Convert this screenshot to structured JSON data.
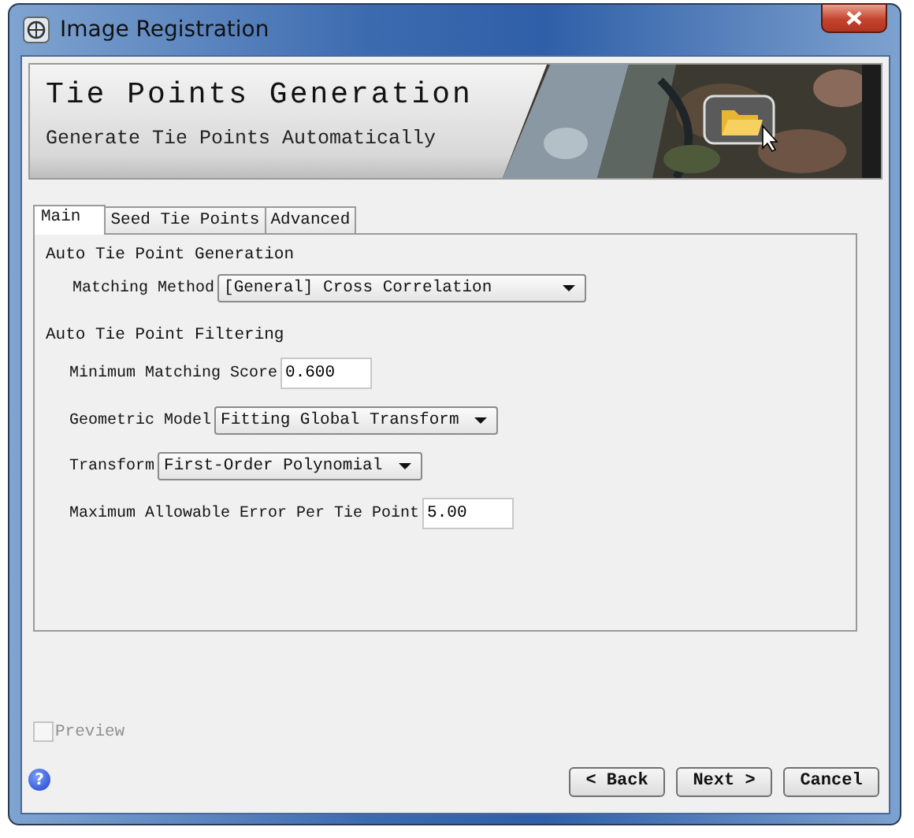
{
  "window": {
    "title": "Image Registration"
  },
  "banner": {
    "title": "Tie Points Generation",
    "subtitle": "Generate Tie Points Automatically"
  },
  "tabs": [
    {
      "label": "Main",
      "selected": true
    },
    {
      "label": "Seed Tie Points",
      "selected": false
    },
    {
      "label": "Advanced",
      "selected": false
    }
  ],
  "sections": [
    {
      "heading": "Auto Tie Point Generation",
      "fields": [
        {
          "kind": "dropdown",
          "label": "Matching Method",
          "value": "[General] Cross Correlation"
        }
      ]
    },
    {
      "heading": "Auto Tie Point Filtering",
      "fields": [
        {
          "kind": "text",
          "label": "Minimum Matching Score",
          "value": "0.600"
        },
        {
          "kind": "dropdown",
          "label": "Geometric Model",
          "value": "Fitting Global Transform"
        },
        {
          "kind": "dropdown",
          "label": "Transform",
          "value": "First-Order Polynomial"
        },
        {
          "kind": "text",
          "label": "Maximum Allowable Error Per Tie Point",
          "value": "5.00"
        }
      ]
    }
  ],
  "preview": {
    "label": "Preview",
    "checked": false,
    "disabled": true
  },
  "help": {
    "symbol": "?"
  },
  "buttons": [
    "< Back",
    "Next >",
    "Cancel"
  ]
}
